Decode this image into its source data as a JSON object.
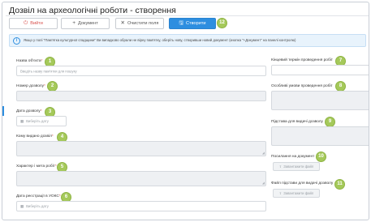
{
  "header": {
    "title": "Дозвіл на археологічні роботи - створення"
  },
  "toolbar": {
    "exit_icon": "power-icon",
    "exit_label": "Вийти",
    "doc_icon": "plus-icon",
    "doc_label": "Документ",
    "clear_icon": "x-icon",
    "clear_label": "Очистити поля",
    "create_icon": "save-icon",
    "create_label": "Створити",
    "create_badge": "12"
  },
  "info": {
    "icon": "info-icon",
    "text": "Якщо у полі \"Пам'ятка культурної спадщини\" Ви випадково обрали не вірну пам'ятку, оберіть нову, створивши новий документ (кнопка \"+Документ\" на панелі контролю)"
  },
  "left_fields": [
    {
      "label": "Назва об'єкта",
      "required": "*",
      "badge": "1",
      "placeholder": "Введіть назву пам'ятки для пошуку"
    },
    {
      "label": "Номер дозволу",
      "required": "*",
      "badge": "2",
      "placeholder": ""
    },
    {
      "label": "Дата дозволу",
      "required": "*",
      "badge": "3",
      "placeholder": "Виберіть дату"
    },
    {
      "label": "Кому видано дозвіл",
      "required": "*",
      "badge": "4",
      "placeholder": ""
    },
    {
      "label": "Характер і мета робіт",
      "required": "*",
      "badge": "5",
      "placeholder": ""
    },
    {
      "label": "Дата реєстрації в УОКС",
      "required": "*",
      "badge": "6",
      "placeholder": "Виберіть дату"
    }
  ],
  "right_fields": [
    {
      "label": "Кінцевий термін проведення робіт",
      "badge": "7"
    },
    {
      "label": "Особливі умови проведення робіт",
      "badge": "8"
    },
    {
      "label": "Підстава для видачі дозволу",
      "badge": "9"
    },
    {
      "label": "Посилання на документ",
      "badge": "10",
      "button": "Завантажити файл"
    },
    {
      "label": "Файл підстави для видачі дозволу",
      "badge": "11",
      "button": "Завантажити файл"
    }
  ],
  "colors": {
    "primary": "#2d8ee0",
    "danger": "#d9534f",
    "badge": "#a5c95a",
    "info_bg": "#e8f3fc"
  }
}
